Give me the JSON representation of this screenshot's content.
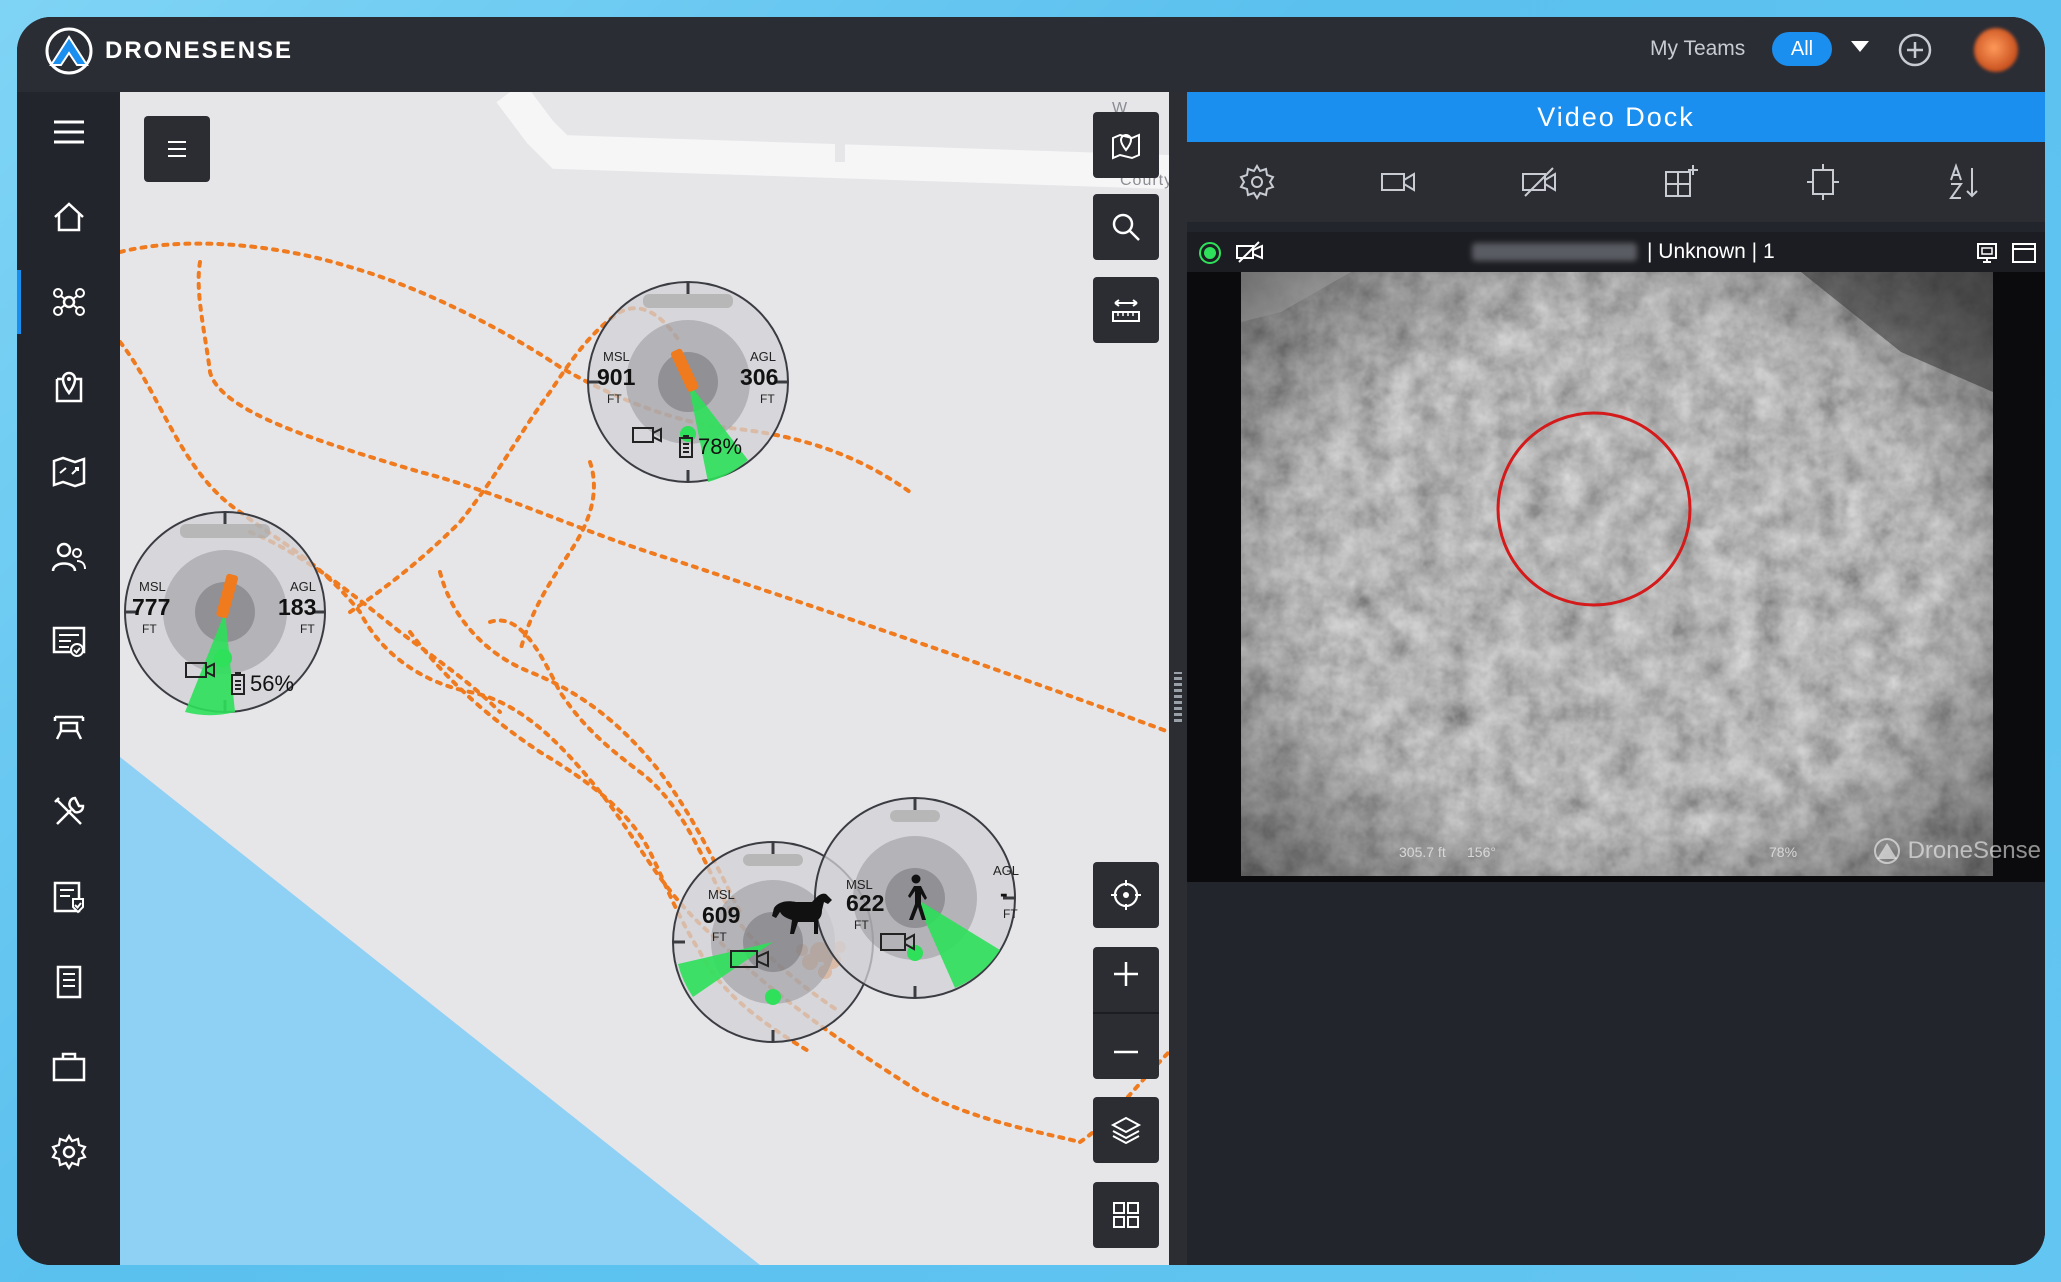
{
  "app": {
    "brand": "DRONESENSE",
    "colors": {
      "accent": "#1a8ff0",
      "flight_path": "#f07a1e",
      "live": "#2ee05a",
      "water": "#8fd0f5"
    }
  },
  "topbar": {
    "teams_label": "My Teams",
    "teams_value": "All",
    "add_icon": "plus-circle-icon"
  },
  "sidebar": {
    "items": [
      {
        "icon": "menu-icon"
      },
      {
        "icon": "home-icon"
      },
      {
        "icon": "drone-ops-icon",
        "active": true
      },
      {
        "icon": "map-pin-icon"
      },
      {
        "icon": "mission-map-icon"
      },
      {
        "icon": "users-icon"
      },
      {
        "icon": "report-icon"
      },
      {
        "icon": "drone-icon"
      },
      {
        "icon": "tools-icon"
      },
      {
        "icon": "checklist-icon"
      },
      {
        "icon": "document-icon"
      },
      {
        "icon": "briefcase-icon"
      },
      {
        "icon": "settings-icon"
      }
    ]
  },
  "map": {
    "streets": [
      "W Court",
      "Courtya"
    ],
    "controls": [
      "list-icon",
      "map-marker-icon",
      "search-icon",
      "measure-icon",
      "crosshair-icon",
      "zoom-in-icon",
      "zoom-out-icon",
      "layers-icon",
      "grid-icon"
    ],
    "drones": [
      {
        "msl": "777",
        "msl_unit": "FT",
        "agl": "183",
        "agl_unit": "FT",
        "battery": "56%",
        "msl_label": "MSL",
        "agl_label": "AGL"
      },
      {
        "msl": "901",
        "msl_unit": "FT",
        "agl": "306",
        "agl_unit": "FT",
        "battery": "78%",
        "msl_label": "MSL",
        "agl_label": "AGL"
      },
      {
        "msl": "609",
        "msl_unit": "FT",
        "msl_label": "MSL",
        "subject": "horse-icon"
      },
      {
        "msl": "622",
        "msl_unit": "FT",
        "agl": "-",
        "agl_unit": "FT",
        "msl_label": "MSL",
        "agl_label": "AGL",
        "subject": "person-walking-icon"
      }
    ]
  },
  "dock": {
    "title": "Video Dock",
    "tools": [
      "settings-icon",
      "camera-icon",
      "camera-off-icon",
      "add-layout-icon",
      "fit-icon",
      "sort-az-icon"
    ],
    "feed": {
      "title": "| Unknown | 1",
      "overlay_left": "305.7 ft",
      "overlay_mid": "156°",
      "overlay_right": "78%",
      "watermark": "DroneSense"
    }
  }
}
